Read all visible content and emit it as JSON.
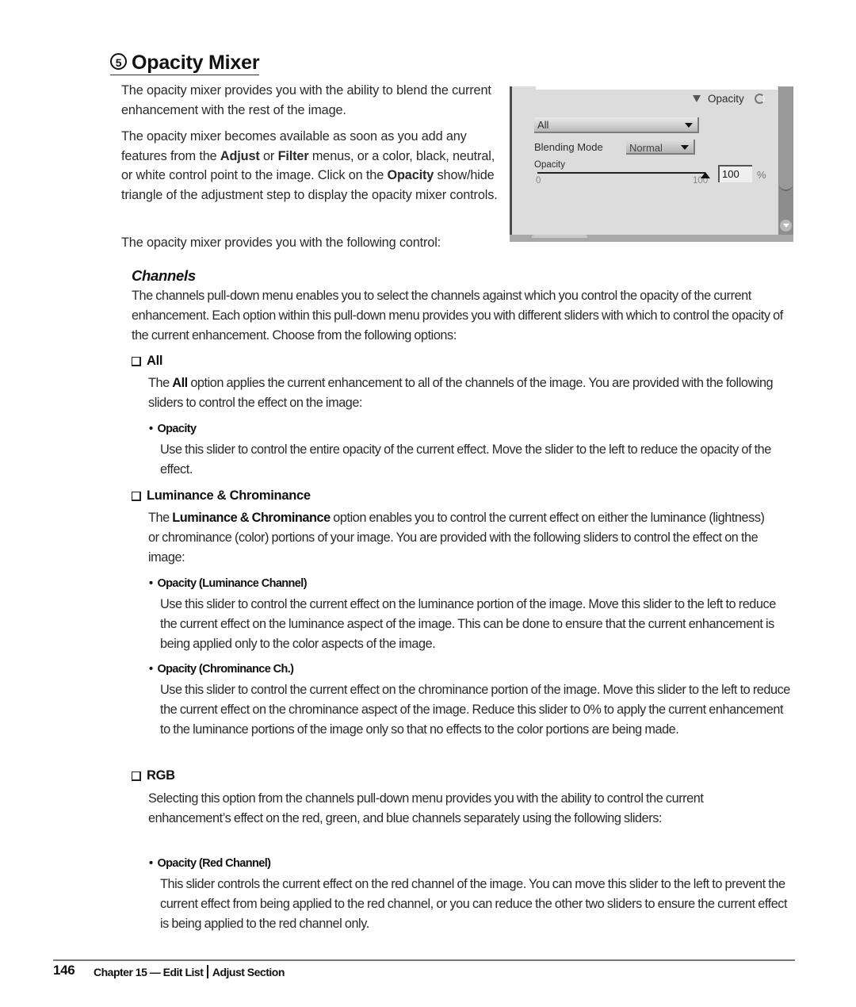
{
  "section": {
    "number": "5",
    "title": "Opacity Mixer"
  },
  "intro": {
    "p1": "The opacity mixer provides you with the ability to blend the current enhancement with the rest of the image.",
    "p2_parts": [
      "The opacity mixer becomes available as soon as you add any features from the ",
      "Adjust",
      " or ",
      "Filter",
      " menus, or a color, black, neutral, or white control point to the image. Click on the ",
      "Opacity",
      " show/hide triangle of the adjustment step to display the opacity mixer controls."
    ],
    "p3": "The opacity mixer provides you with the following control:"
  },
  "screenshot": {
    "toggle_label": "Opacity",
    "channel_dropdown_value": "All",
    "blending_mode_label": "Blending Mode",
    "blending_mode_value": "Normal",
    "slider_label": "Opacity",
    "slider_min": "0",
    "slider_max": "100",
    "slider_value_fraction": 1.0,
    "value_field": "100",
    "unit": "%"
  },
  "channels": {
    "heading": "Channels",
    "description": "The channels pull-down menu enables you to select the channels against which you control the opacity of the current enhancement. Each option within this pull-down menu provides you with different sliders with which to control the opacity of the current enhancement. Choose from the following options:",
    "options": [
      {
        "name": "All",
        "desc_parts": [
          "The ",
          "All",
          " option applies the current enhancement to all of the channels of the image. You are provided with the following sliders to control the effect on the image:"
        ],
        "sliders": [
          {
            "name": "Opacity",
            "desc": "Use this slider to control the entire opacity of the current effect. Move the slider to the left to reduce the opacity of the effect."
          }
        ]
      },
      {
        "name": "Luminance & Chrominance",
        "desc_parts": [
          "The ",
          "Luminance & Chrominance",
          " option enables you to control the current effect on either the luminance (lightness) or chrominance (color) portions of your image. You are provided with the following sliders to control the effect on the image:"
        ],
        "sliders": [
          {
            "name": "Opacity (Luminance Channel)",
            "desc": "Use this slider to control the current effect on the luminance portion of the image. Move this slider to the left to reduce the current effect on the luminance aspect of the image. This can be done to ensure that the current enhancement is being applied only to the color aspects of the image."
          },
          {
            "name": "Opacity (Chrominance Ch.)",
            "desc": "Use this slider to control the current effect on the chrominance portion of the image. Move this slider to the left to reduce the current effect on the chrominance aspect of the image. Reduce this slider to 0% to apply the current enhancement to the luminance portions of the image only so that no effects to the color portions are being made."
          }
        ]
      },
      {
        "name": "RGB",
        "desc": "Selecting this option from the channels pull-down menu provides you with the ability to control the current enhancement’s effect on the red, green, and blue channels separately using the following sliders:",
        "sliders": [
          {
            "name": "Opacity (Red Channel)",
            "desc": "This slider controls the current effect on the red channel of the image. You can move this slider to the left to prevent the current effect from being applied to the red channel, or you can reduce the other two sliders to ensure the current effect is being applied to the red channel only."
          }
        ]
      }
    ]
  },
  "footer": {
    "page_number": "146",
    "chapter": "Chapter 15 — Edit List",
    "section": "Adjust Section"
  }
}
